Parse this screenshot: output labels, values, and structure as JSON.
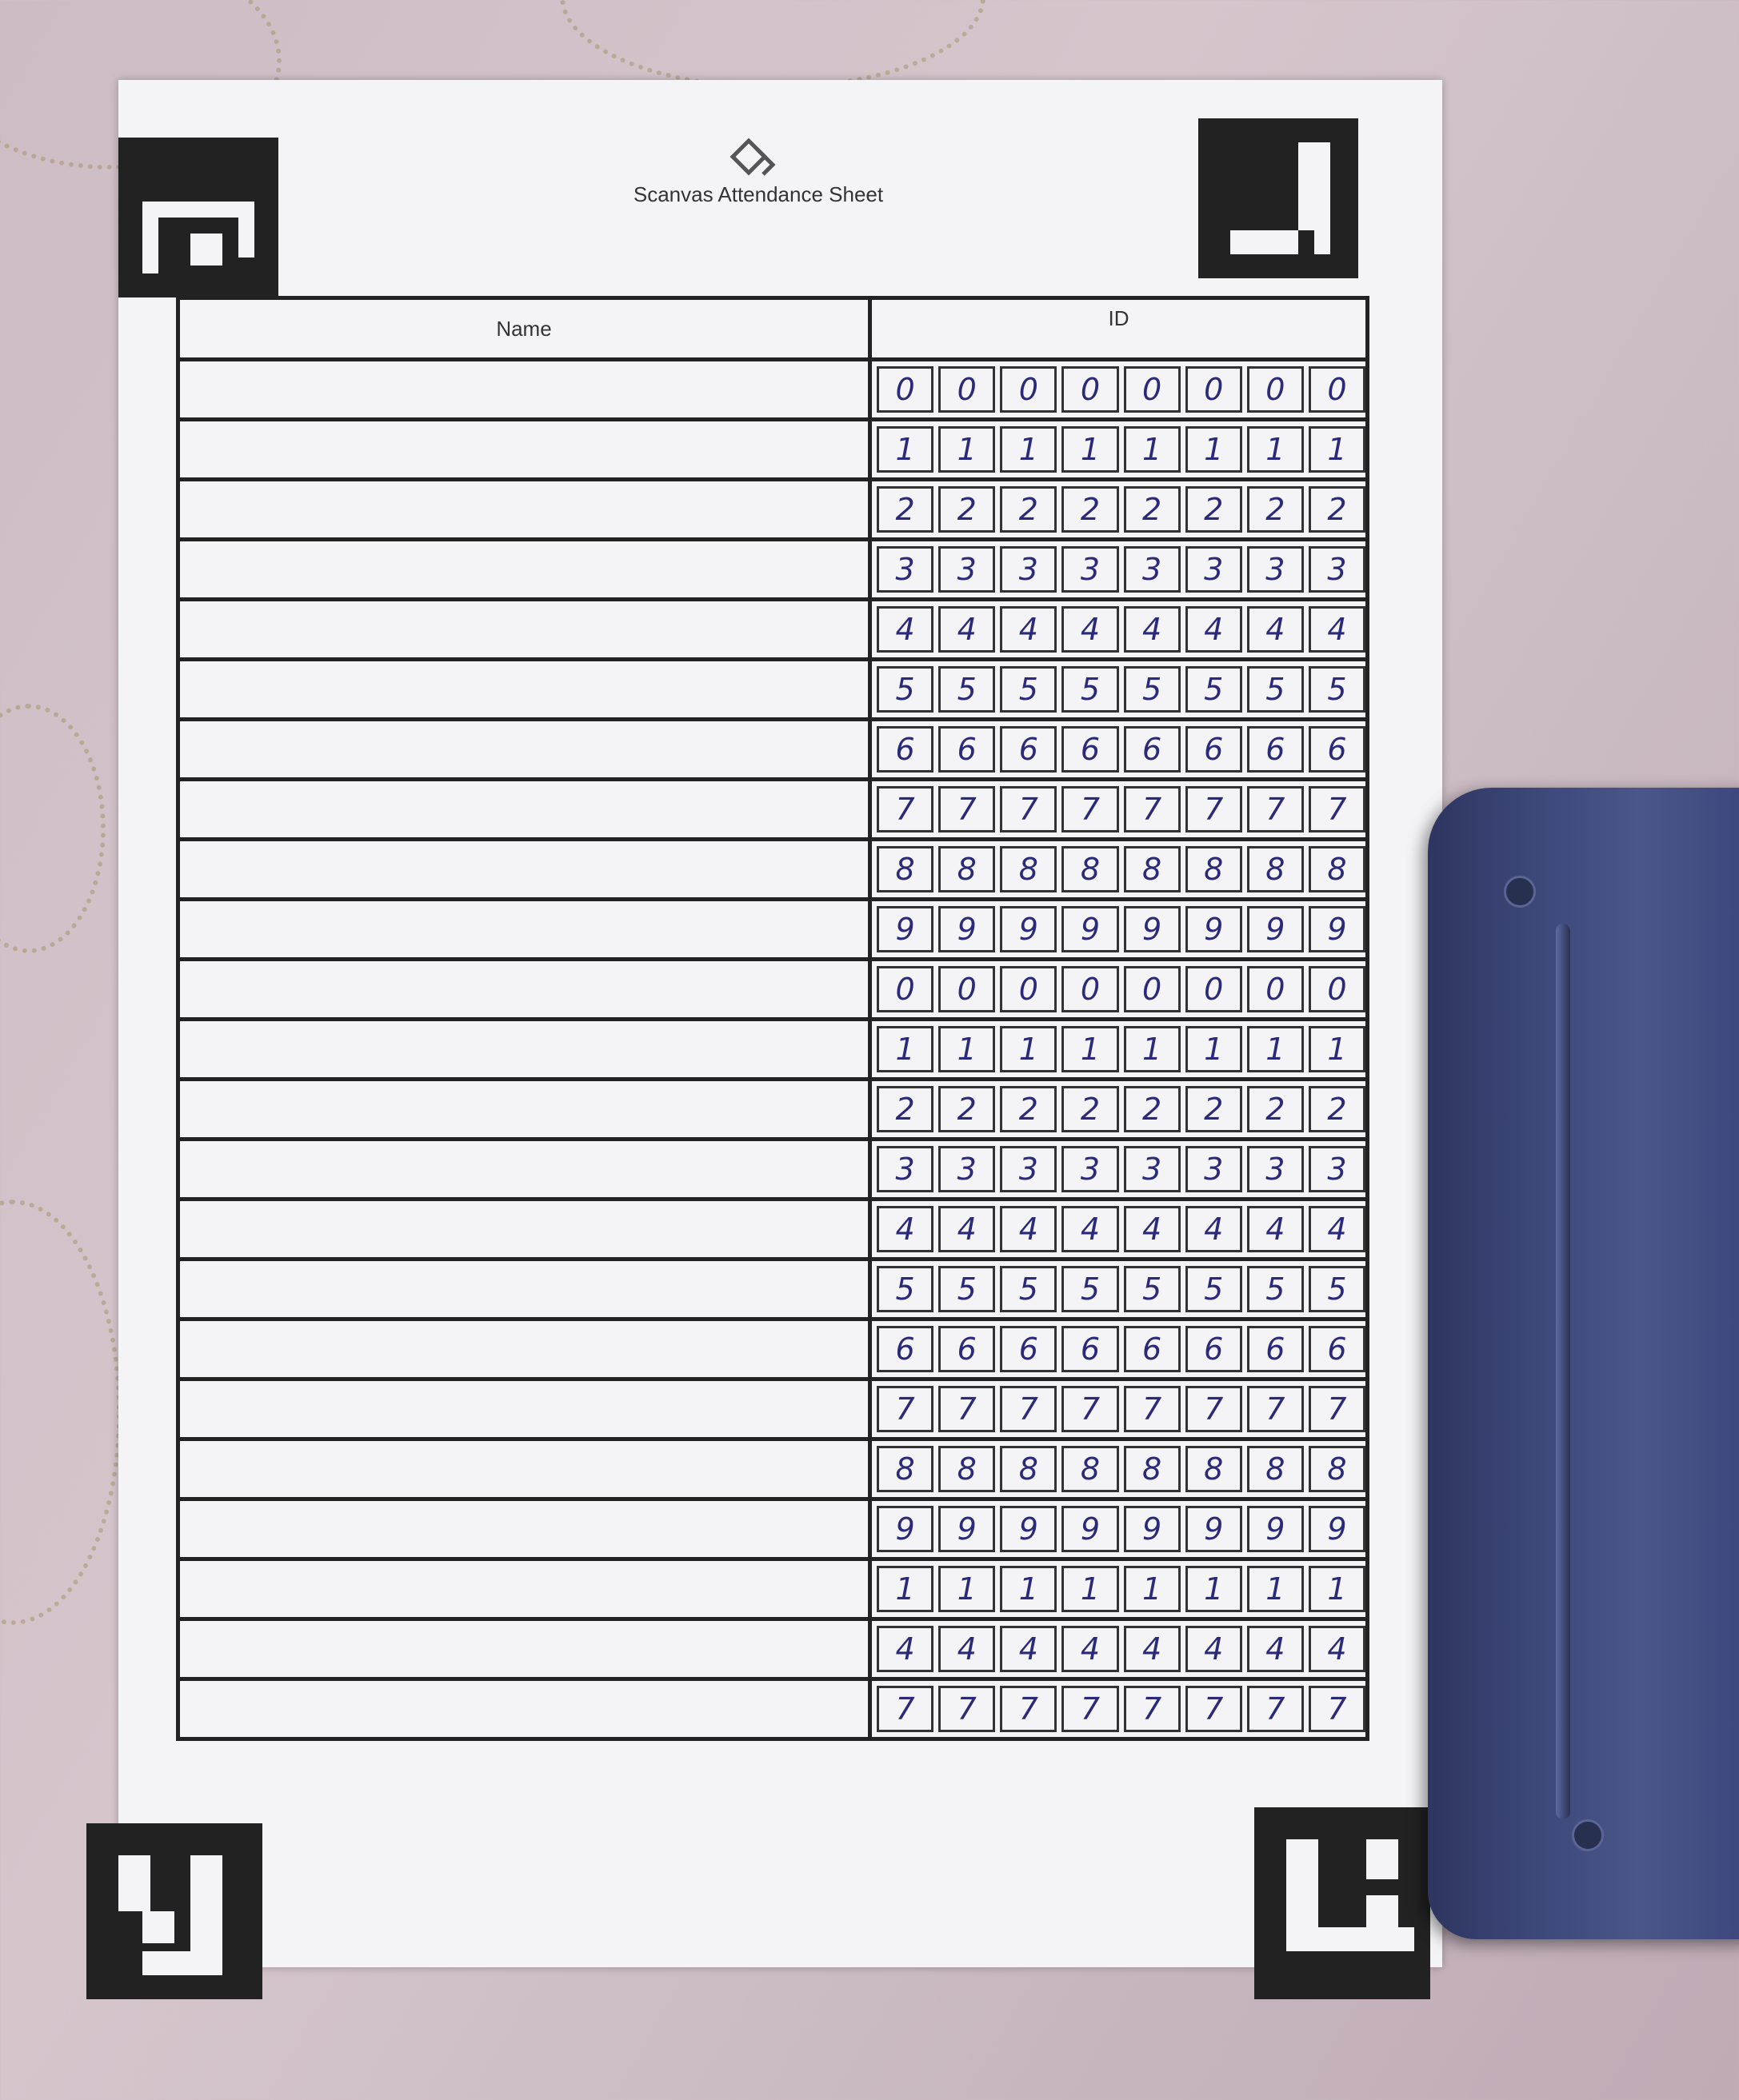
{
  "sheet": {
    "title": "Scanvas Attendance Sheet",
    "columns": {
      "name": "Name",
      "id": "ID"
    },
    "rows": [
      [
        "0",
        "0",
        "0",
        "0",
        "0",
        "0",
        "0",
        "0"
      ],
      [
        "1",
        "1",
        "1",
        "1",
        "1",
        "1",
        "1",
        "1"
      ],
      [
        "2",
        "2",
        "2",
        "2",
        "2",
        "2",
        "2",
        "2"
      ],
      [
        "3",
        "3",
        "3",
        "3",
        "3",
        "3",
        "3",
        "3"
      ],
      [
        "4",
        "4",
        "4",
        "4",
        "4",
        "4",
        "4",
        "4"
      ],
      [
        "5",
        "5",
        "5",
        "5",
        "5",
        "5",
        "5",
        "5"
      ],
      [
        "6",
        "6",
        "6",
        "6",
        "6",
        "6",
        "6",
        "6"
      ],
      [
        "7",
        "7",
        "7",
        "7",
        "7",
        "7",
        "7",
        "7"
      ],
      [
        "8",
        "8",
        "8",
        "8",
        "8",
        "8",
        "8",
        "8"
      ],
      [
        "9",
        "9",
        "9",
        "9",
        "9",
        "9",
        "9",
        "9"
      ],
      [
        "0",
        "0",
        "0",
        "0",
        "0",
        "0",
        "0",
        "0"
      ],
      [
        "1",
        "1",
        "1",
        "1",
        "1",
        "1",
        "1",
        "1"
      ],
      [
        "2",
        "2",
        "2",
        "2",
        "2",
        "2",
        "2",
        "2"
      ],
      [
        "3",
        "3",
        "3",
        "3",
        "3",
        "3",
        "3",
        "3"
      ],
      [
        "4",
        "4",
        "4",
        "4",
        "4",
        "4",
        "4",
        "4"
      ],
      [
        "5",
        "5",
        "5",
        "5",
        "5",
        "5",
        "5",
        "5"
      ],
      [
        "6",
        "6",
        "6",
        "6",
        "6",
        "6",
        "6",
        "6"
      ],
      [
        "7",
        "7",
        "7",
        "7",
        "7",
        "7",
        "7",
        "7"
      ],
      [
        "8",
        "8",
        "8",
        "8",
        "8",
        "8",
        "8",
        "8"
      ],
      [
        "9",
        "9",
        "9",
        "9",
        "9",
        "9",
        "9",
        "9"
      ],
      [
        "1",
        "1",
        "1",
        "1",
        "1",
        "1",
        "1",
        "1"
      ],
      [
        "4",
        "4",
        "4",
        "4",
        "4",
        "4",
        "4",
        "4"
      ],
      [
        "7",
        "7",
        "7",
        "7",
        "7",
        "7",
        "7",
        "7"
      ]
    ]
  },
  "colors": {
    "ink": "#2b2a7a",
    "marker": "#222222",
    "paper": "#f4f4f6",
    "stapler": "#3f4a7c"
  },
  "icons": {
    "logo": "scanvas-logo-icon"
  }
}
